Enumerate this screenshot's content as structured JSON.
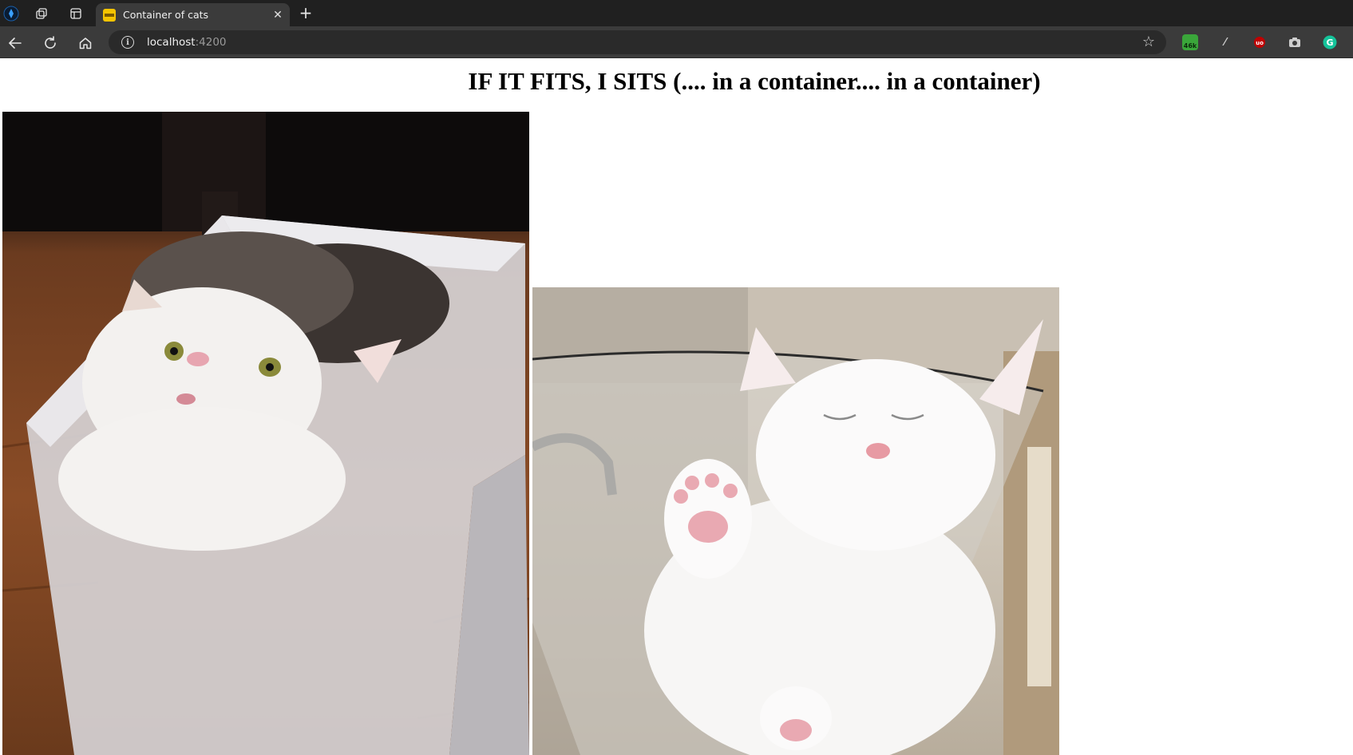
{
  "browser": {
    "tab": {
      "title": "Container of cats"
    },
    "address_bar": {
      "host": "localhost",
      "port": ":4200"
    },
    "extensions": [
      {
        "name": "extension-badge-icon",
        "badge": "46k",
        "color": "#3aa63a"
      },
      {
        "name": "eyedropper-icon",
        "color": "#cfcfcf"
      },
      {
        "name": "ublock-icon",
        "badge": "uo",
        "color": "#c00000"
      },
      {
        "name": "camera-icon",
        "color": "#cfcfcf"
      },
      {
        "name": "grammarly-icon",
        "badge": "G",
        "color": "#15c39a"
      }
    ]
  },
  "page": {
    "heading": "IF IT FITS, I SITS (.... in a container.... in a container)",
    "images": [
      {
        "subject": "tabby-and-white kitten in a translucent plastic box"
      },
      {
        "subject": "white kitten sleeping in a glass vase"
      }
    ]
  }
}
